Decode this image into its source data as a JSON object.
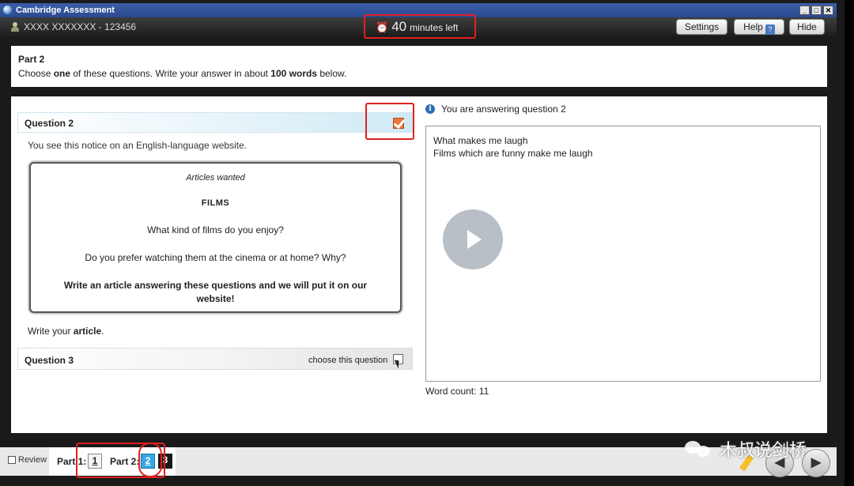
{
  "window": {
    "title": "Cambridge Assessment"
  },
  "header": {
    "candidate": "XXXX XXXXXXX - 123456",
    "timer_value": "40",
    "timer_text": "minutes left",
    "buttons": {
      "settings": "Settings",
      "help": "Help",
      "help_icon": "?",
      "hide": "Hide"
    }
  },
  "instructions": {
    "part_title": "Part 2",
    "text_pre": "Choose ",
    "text_bold1": "one",
    "text_mid": " of these questions. Write your answer in about ",
    "text_bold2": "100 words",
    "text_post": " below."
  },
  "question2": {
    "label": "Question 2",
    "checked": true,
    "intro": "You see this notice on an English-language website.",
    "notice": {
      "kicker": "Articles wanted",
      "title": "FILMS",
      "q1": "What kind of films do you enjoy?",
      "q2": "Do you prefer watching them at the cinema or at home? Why?",
      "cta": "Write an article answering these questions and we will put it on our website!"
    },
    "write_pre": "Write your ",
    "write_bold": "article",
    "write_post": "."
  },
  "question3": {
    "label": "Question 3",
    "choose_text": "choose this question",
    "checked": false
  },
  "answer": {
    "status": "You are answering question 2",
    "lines": [
      "What makes me laugh",
      "Films which are funny make me laugh"
    ],
    "word_count_label": "Word count: 11"
  },
  "nav": {
    "review": "Review",
    "part1_label": "Part 1:",
    "part1_items": [
      "1"
    ],
    "part2_label": "Part 2:",
    "part2_items": [
      "2",
      "3"
    ],
    "current": "2"
  },
  "watermark": {
    "text": "木叔说剑桥"
  },
  "colors": {
    "highlight_red": "#e02020",
    "accent_blue": "#3aa6e0",
    "check_orange": "#e8773a"
  }
}
